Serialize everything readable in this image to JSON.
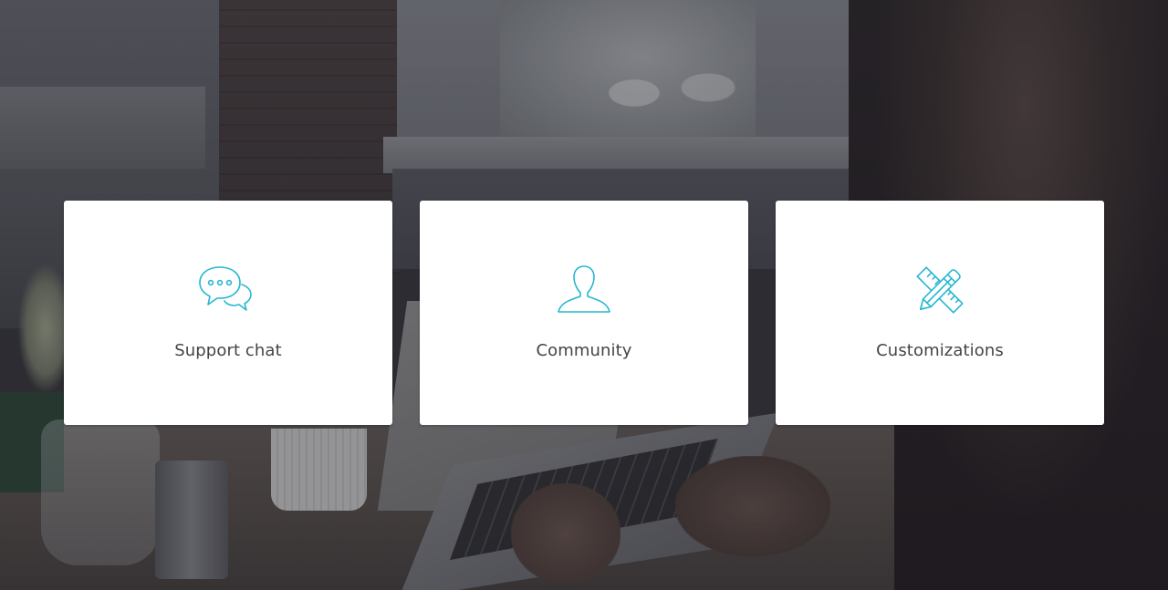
{
  "accent_color": "#26b7d2",
  "cards": [
    {
      "label": "Support chat",
      "icon": "speech-bubbles-icon"
    },
    {
      "label": "Community",
      "icon": "user-icon"
    },
    {
      "label": "Customizations",
      "icon": "pencil-ruler-icon"
    }
  ]
}
